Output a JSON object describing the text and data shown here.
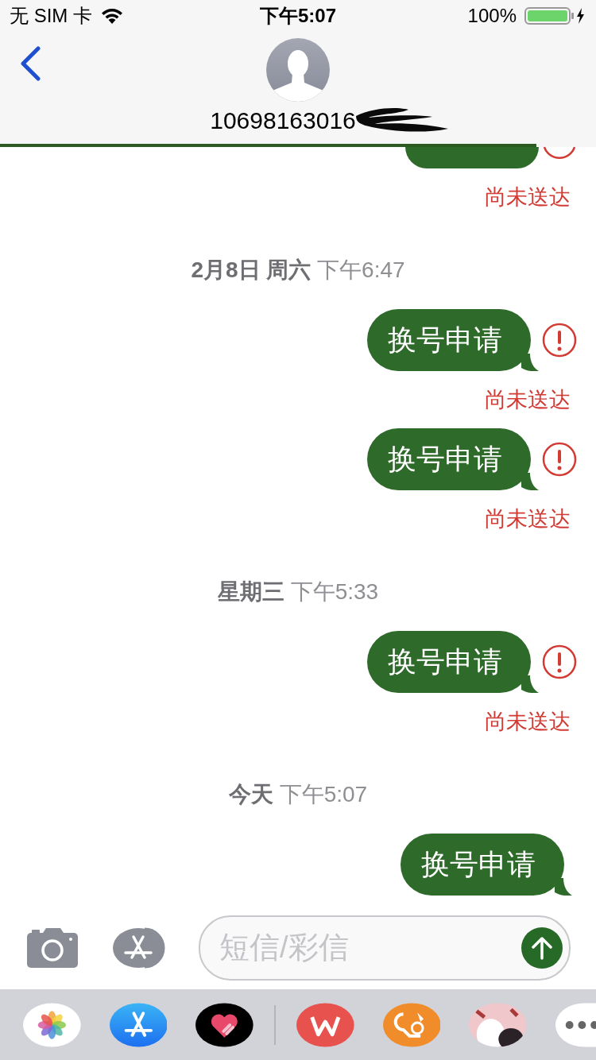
{
  "status_bar": {
    "carrier": "无 SIM 卡",
    "time": "下午5:07",
    "battery": "100%"
  },
  "header": {
    "contact": "10698163016",
    "send_progress": {
      "level": 0.9
    }
  },
  "messages": [
    {
      "kind": "partial",
      "failed": true,
      "status": "尚未送达"
    },
    {
      "kind": "timestamp",
      "text": "**2月8日 周六** 下午6:47"
    },
    {
      "kind": "message",
      "text": "换号申请",
      "failed": true,
      "status": "尚未送达"
    },
    {
      "kind": "message",
      "text": "换号申请",
      "failed": true,
      "status": "尚未送达"
    },
    {
      "kind": "timestamp",
      "text": "**星期三** 下午5:33"
    },
    {
      "kind": "message",
      "text": "换号申请",
      "failed": true,
      "status": "尚未送达"
    },
    {
      "kind": "timestamp",
      "text": "**今天** 下午5:07"
    },
    {
      "kind": "message",
      "text": "换号申请",
      "failed": false
    }
  ],
  "composer": {
    "placeholder": "短信/彩信"
  },
  "app_drawer": [
    {
      "kind": "photos"
    },
    {
      "kind": "appstore"
    },
    {
      "kind": "heart"
    },
    {
      "kind": "divider"
    },
    {
      "kind": "office"
    },
    {
      "kind": "squirrel"
    },
    {
      "kind": "sticker"
    },
    {
      "kind": "more"
    }
  ]
}
